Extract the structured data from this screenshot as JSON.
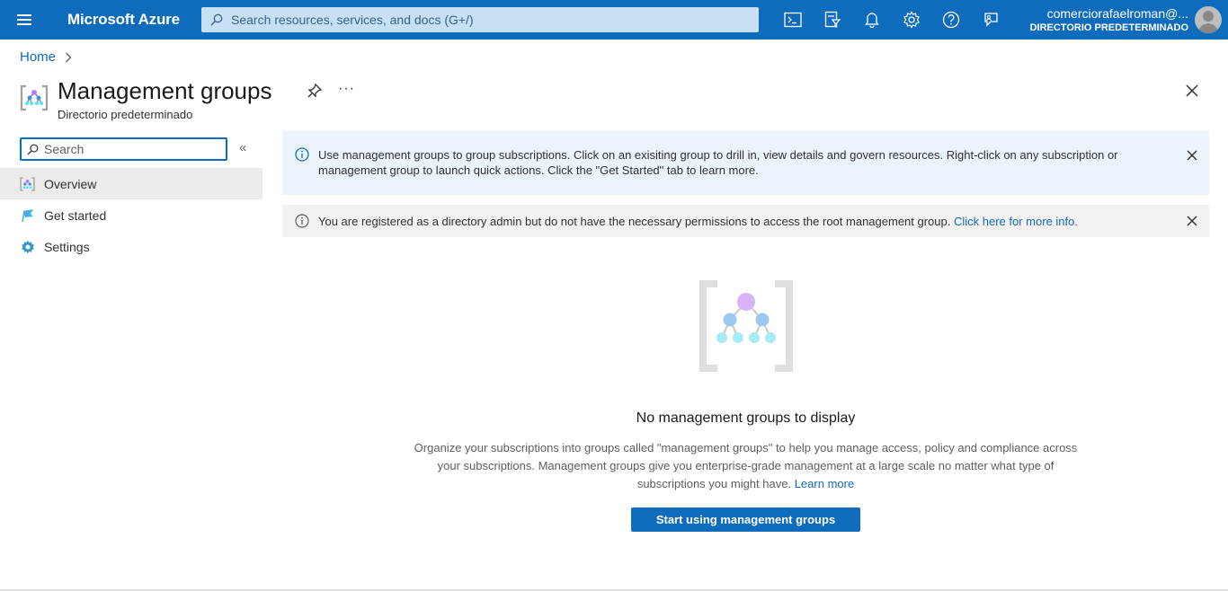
{
  "topbar": {
    "brand": "Microsoft Azure",
    "search_placeholder": "Search resources, services, and docs (G+/)",
    "account_name": "comerciorafaelroman@...",
    "account_directory": "DIRECTORIO PREDETERMINADO"
  },
  "breadcrumb": {
    "home": "Home"
  },
  "blade": {
    "title": "Management groups",
    "subtitle": "Directorio predeterminado",
    "more": "···"
  },
  "nav": {
    "search_placeholder": "Search",
    "collapse": "«",
    "items": [
      {
        "label": "Overview",
        "icon": "management-groups-icon",
        "selected": true
      },
      {
        "label": "Get started",
        "icon": "flag-icon",
        "selected": false
      },
      {
        "label": "Settings",
        "icon": "gear-icon",
        "selected": false
      }
    ]
  },
  "banners": {
    "info_text": "Use management groups to group subscriptions. Click on an exisiting group to drill in, view details and govern resources. Right-click on any subscription or management group to launch quick actions. Click the \"Get Started\" tab to learn more.",
    "warn_text": "You are registered as a directory admin but do not have the necessary permissions to access the root management group.",
    "warn_link": "Click here for more info."
  },
  "empty_state": {
    "heading": "No management groups to display",
    "description": "Organize your subscriptions into groups called \"management groups\" to help you manage access, policy and compliance across your subscriptions. Management groups give you enterprise-grade management at a large scale no matter what type of subscriptions you might have.",
    "learn_more": "Learn more",
    "cta": "Start using management groups"
  },
  "colors": {
    "accent": "#0f6cbd",
    "info_bg": "#ebf3fc",
    "warn_bg": "#f3f2f1",
    "nav_selected": "#edebe9"
  }
}
